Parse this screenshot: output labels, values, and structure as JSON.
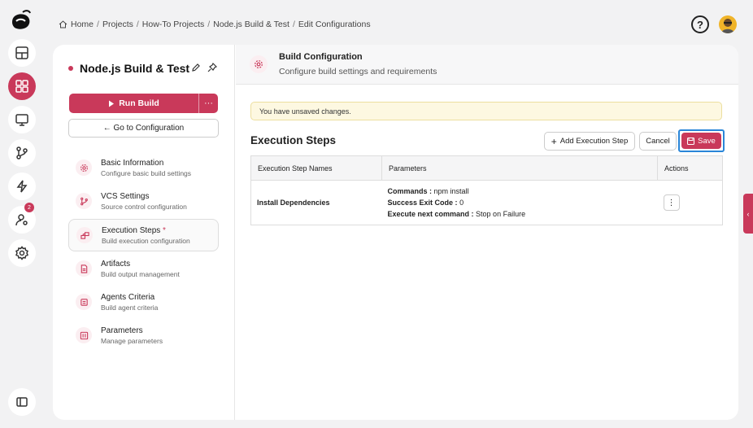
{
  "breadcrumb": {
    "home": "Home",
    "projects": "Projects",
    "howto": "How-To Projects",
    "build": "Node.js Build & Test",
    "current": "Edit Configurations",
    "separator": "/"
  },
  "rail": {
    "badge_count": "2"
  },
  "project": {
    "title": "Node.js Build & Test",
    "run_label": "Run Build",
    "more_label": "···",
    "goto_label": "← Go to Configuration"
  },
  "nav": [
    {
      "title": "Basic Information",
      "subtitle": "Configure basic build settings",
      "icon": "gear-icon"
    },
    {
      "title": "VCS Settings",
      "subtitle": "Source control configuration",
      "icon": "branch-icon"
    },
    {
      "title": "Execution Steps",
      "star": "*",
      "subtitle": "Build execution configuration",
      "icon": "steps-icon"
    },
    {
      "title": "Artifacts",
      "subtitle": "Build output management",
      "icon": "document-icon"
    },
    {
      "title": "Agents Criteria",
      "subtitle": "Build agent criteria",
      "icon": "agent-icon"
    },
    {
      "title": "Parameters",
      "subtitle": "Manage parameters",
      "icon": "parameters-icon"
    }
  ],
  "panel": {
    "title": "Build Configuration",
    "subtitle": "Configure build settings and requirements"
  },
  "warning": "You have unsaved changes.",
  "section": {
    "title": "Execution Steps",
    "add_label": "Add Execution Step",
    "cancel_label": "Cancel",
    "save_label": "Save"
  },
  "table": {
    "headers": [
      "Execution Step Names",
      "Parameters",
      "Actions"
    ],
    "rows": [
      {
        "name": "Install Dependencies",
        "commands_label": "Commands :",
        "commands_value": "npm install",
        "exit_label": "Success Exit Code :",
        "exit_value": "0",
        "next_label": "Execute next command :",
        "next_value": "Stop on Failure",
        "action": "⋮"
      }
    ]
  },
  "colors": {
    "accent": "#c9395a",
    "focus": "#2a86d8",
    "warning_bg": "#fdf8e1"
  }
}
